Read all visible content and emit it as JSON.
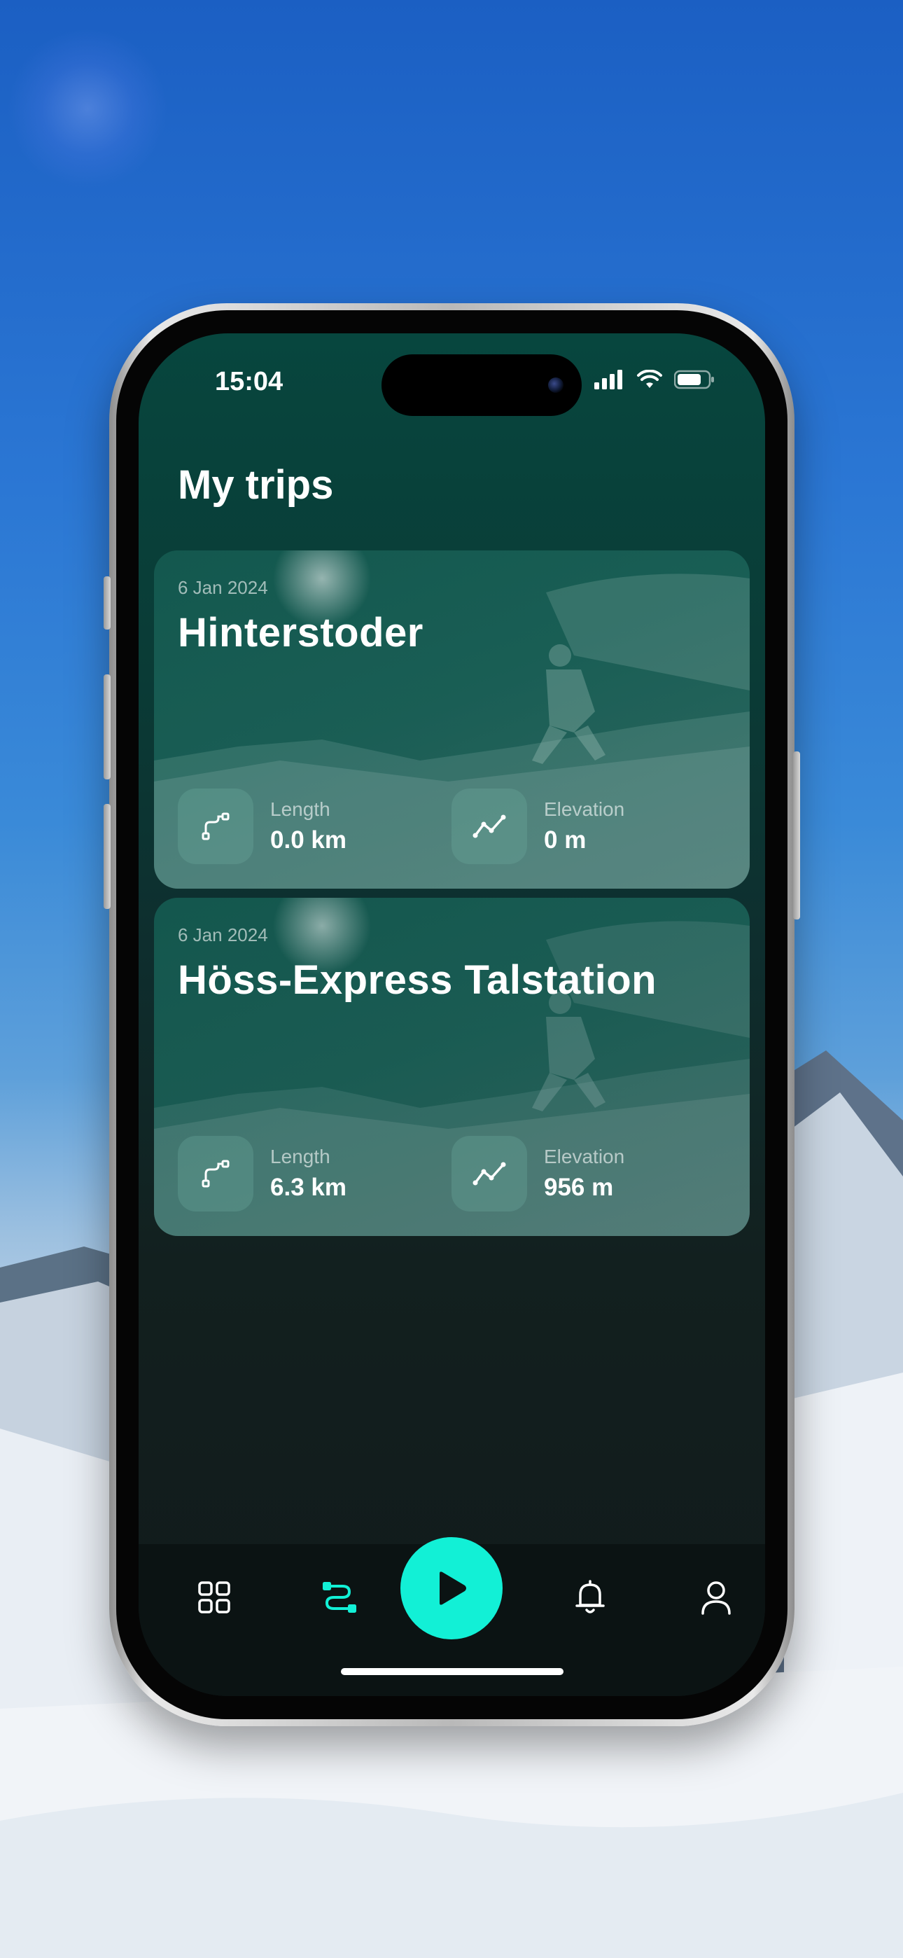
{
  "status_bar": {
    "time": "15:04"
  },
  "page": {
    "title": "My trips"
  },
  "trips": [
    {
      "date": "6 Jan 2024",
      "name": "Hinterstoder",
      "length_label": "Length",
      "length_value": "0.0 km",
      "elevation_label": "Elevation",
      "elevation_value": "0 m"
    },
    {
      "date": "6 Jan 2024",
      "name": "Höss-Express Talstation",
      "length_label": "Length",
      "length_value": "6.3 km",
      "elevation_label": "Elevation",
      "elevation_value": "956 m"
    }
  ],
  "tab_bar": {
    "items": [
      {
        "icon": "grid-icon",
        "active": false
      },
      {
        "icon": "route-icon",
        "active": true
      },
      {
        "icon": "play-icon",
        "active": false
      },
      {
        "icon": "bell-icon",
        "active": false
      },
      {
        "icon": "profile-icon",
        "active": false
      }
    ],
    "accent_color": "#12f0d6"
  }
}
